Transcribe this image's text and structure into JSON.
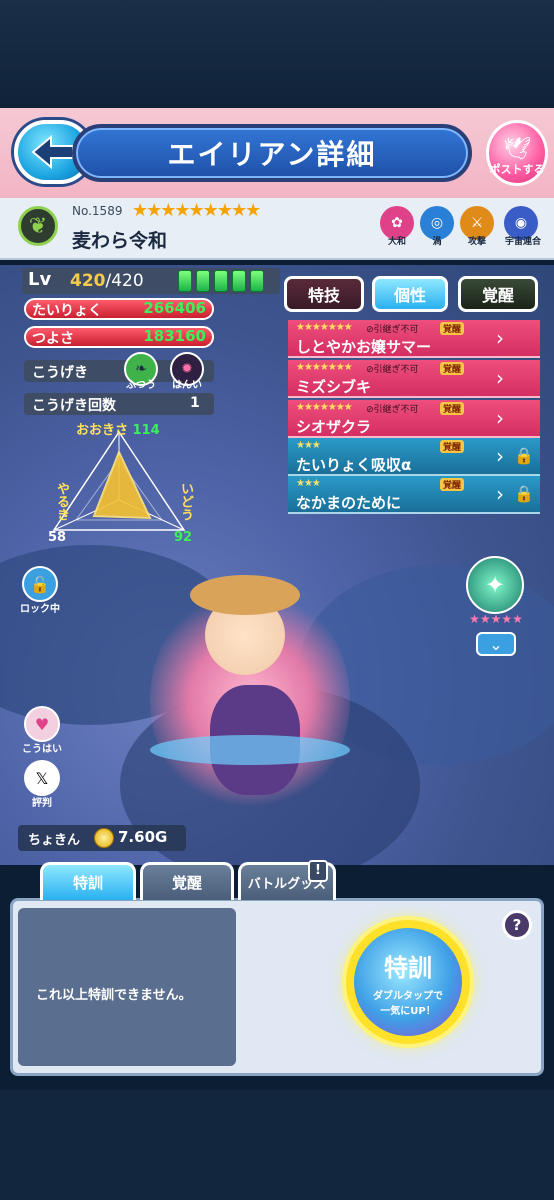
{
  "header": {
    "title": "エイリアン詳細",
    "post_label": "ポストする"
  },
  "unit": {
    "number": "No.1589",
    "stars": "★★★★★★★★★",
    "name": "麦わら令和",
    "tags": [
      {
        "label": "大和",
        "color": "#e0428a",
        "glyph": "✿"
      },
      {
        "label": "渦",
        "color": "#2a7fd6",
        "glyph": "◎"
      },
      {
        "label": "攻撃",
        "color": "#e08a1a",
        "glyph": "⚔"
      },
      {
        "label": "宇宙連合",
        "color": "#3a5cc6",
        "glyph": "◉"
      }
    ]
  },
  "stats": {
    "lv_label": "Lv",
    "lv_current": "420",
    "lv_max": "/420",
    "hp_label": "たいりょく",
    "hp_value": "266406",
    "atk_label": "つよさ",
    "atk_value": "183160",
    "attack_label": "こうげき",
    "attack_type1": "ふつう",
    "attack_type2": "はんい",
    "hits_label": "こうげき回数",
    "hits_value": "1",
    "size_label": "おおきさ",
    "size_value": "114",
    "will_label": "やるき",
    "will_value": "58",
    "move_label": "いどう",
    "move_value": "92"
  },
  "top_tabs": [
    "特技",
    "個性",
    "覚醒"
  ],
  "abilities": [
    {
      "stars": "★★★★★★★",
      "note": "⊘引継ぎ不可",
      "awaken": "覚醒",
      "name": "しとやかお嬢サマー",
      "locked": false
    },
    {
      "stars": "★★★★★★★",
      "note": "⊘引継ぎ不可",
      "awaken": "覚醒",
      "name": "ミズシブキ",
      "locked": false
    },
    {
      "stars": "★★★★★★★",
      "note": "⊘引継ぎ不可",
      "awaken": "覚醒",
      "name": "シオザクラ",
      "locked": false
    },
    {
      "stars": "★★★",
      "note": "",
      "awaken": "覚醒",
      "name": "たいりょく吸収α",
      "locked": true
    },
    {
      "stars": "★★★",
      "note": "",
      "awaken": "覚醒",
      "name": "なかまのために",
      "locked": true
    }
  ],
  "side": {
    "lock_label": "ロック中",
    "kouhai_label": "こうはい",
    "review_label": "評判",
    "equip_stars": "★★★★★"
  },
  "money": {
    "label": "ちょきん",
    "value": "7.60G"
  },
  "bottom_tabs": [
    "特訓",
    "覚醒",
    "バトルグッズ"
  ],
  "bottom_badge": "!",
  "message": "これ以上特訓できません。",
  "train_button": {
    "title": "特訓",
    "sub1": "ダブルタップで",
    "sub2": "一気にUP！"
  },
  "help_icon": "?"
}
